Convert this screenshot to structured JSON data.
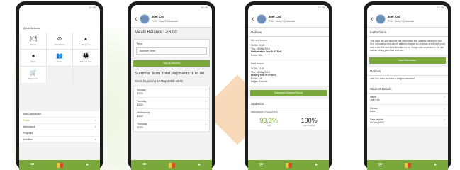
{
  "brand": {
    "accent": "#7aa83a"
  },
  "profile": {
    "name": "Joel Cox",
    "subtitle": "PHD Year 9 Coincide"
  },
  "quick_actions": {
    "title": "Quick Actions",
    "items": [
      {
        "icon": "lunch-icon",
        "label": "Meals"
      },
      {
        "icon": "attendance-icon",
        "label": "Attendance"
      },
      {
        "icon": "progress-icon",
        "label": "Progress"
      },
      {
        "icon": "location-icon",
        "label": "Trips"
      },
      {
        "icon": "people-icon",
        "label": "Clubs"
      },
      {
        "icon": "parent-icon",
        "label": "Parents Eve"
      },
      {
        "icon": "cart-icon",
        "label": "Payments"
      }
    ],
    "menu": [
      {
        "label": "Main Dashboard",
        "arrow": ""
      },
      {
        "label": "Profile",
        "arrow": ">"
      },
      {
        "label": "Attendance",
        "arrow": ">"
      },
      {
        "label": "Progress",
        "arrow": ""
      },
      {
        "label": "Activities",
        "arrow": "v"
      }
    ]
  },
  "meals": {
    "balance": "Meals Balance: -£6.00",
    "term_label": "Term",
    "term_value": "Summer Term",
    "topup": "Top up Account",
    "total": "Summer Term Total Payments: £18.00",
    "week": "Week beginning 13 May 2019: £6.00",
    "days": [
      {
        "day": "Monday",
        "amount": "£3.00"
      },
      {
        "day": "Tuesday",
        "amount": "£3.00"
      },
      {
        "day": "Wednesday",
        "amount": "£3.00"
      },
      {
        "day": "Thursday",
        "amount": "£0.00"
      }
    ]
  },
  "timetable": {
    "notices": "Notices",
    "current_label": "Current lesson",
    "current": [
      "10:00 - 10:45",
      "Thu, 16 May 2019",
      "Mathematics Year 9: 9YSet2",
      "Room: 10A"
    ],
    "next_label": "Next lesson",
    "next": [
      "11:00 - 11:45",
      "Thu, 16 May 2019",
      "History Year 9: 9YSet2",
      "Room: 41B",
      "Megan Roberts"
    ],
    "download": "Download Student Report",
    "statistics": "Statistics",
    "attendance": "Attendance (2018/2019)",
    "stat1_value": "93.3%",
    "stat1_label": "Year",
    "stat2_value": "100%",
    "stat2_label": "Last 4 weeks"
  },
  "details": {
    "instructions_title": "Instructions",
    "instructions": "This page lets you add and edit information and question details for Joel Cox. Information that can be edited is marked by an arrow at the right hand side of the line that the information is on. Simply click anywhere in the line and an editing panel will slide out.",
    "add_info": "Add Information",
    "notices": "Notices",
    "notice_text": "Joel Cox does not have a religion recorded",
    "student_details": "Student Details",
    "fields": [
      {
        "label": "Name",
        "value": "Joel Cox"
      },
      {
        "label": "Gender",
        "value": "Male"
      },
      {
        "label": "Date of birth",
        "value": "09 Dec 2004"
      }
    ]
  },
  "status_time": "12:45"
}
